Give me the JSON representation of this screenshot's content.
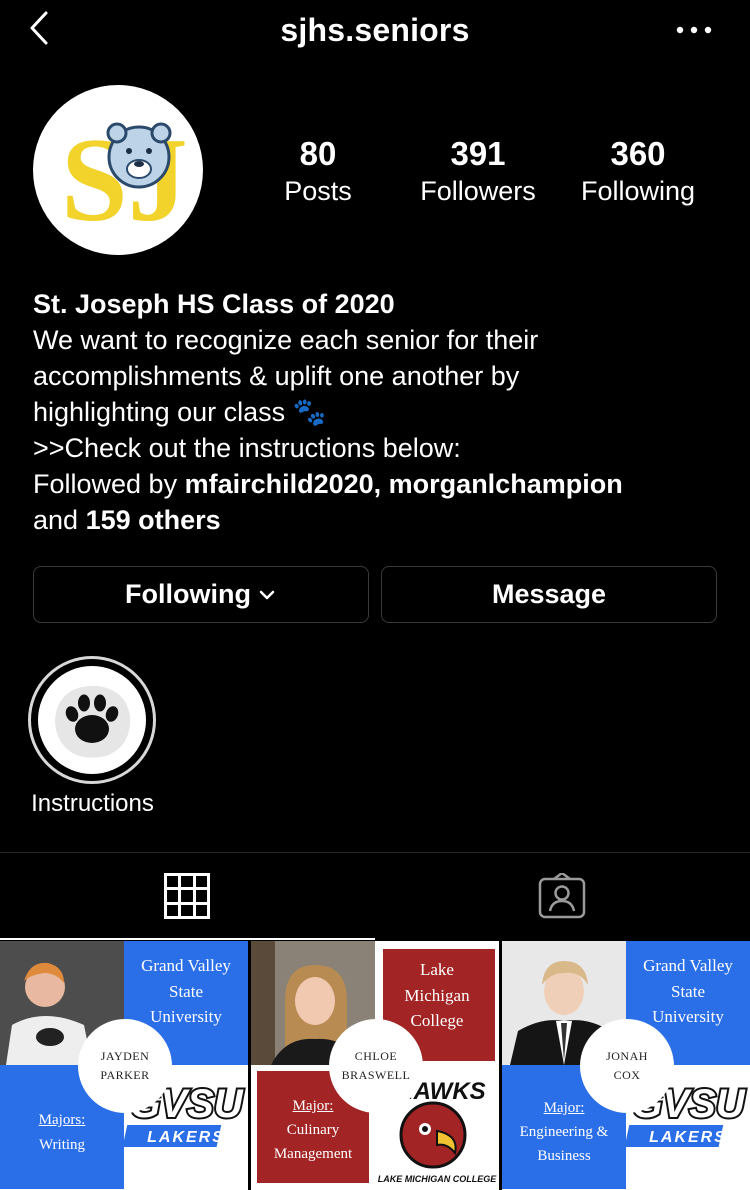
{
  "header": {
    "username": "sjhs.seniors"
  },
  "profile": {
    "avatar_text": "SJ",
    "stats": [
      {
        "value": "80",
        "label": "Posts"
      },
      {
        "value": "391",
        "label": "Followers"
      },
      {
        "value": "360",
        "label": "Following"
      }
    ],
    "display_name": "St. Joseph HS Class of 2020",
    "bio_lines": [
      "We want to recognize each senior for their",
      "accomplishments & uplift one another by",
      "highlighting our class 🐾",
      ">>Check out the instructions below:"
    ],
    "followed_by_prefix": "Followed by ",
    "followed_by_users": "mfairchild2020, morganlchampion",
    "followed_by_and": "and ",
    "followed_by_others": "159 others"
  },
  "actions": {
    "following_label": "Following",
    "message_label": "Message"
  },
  "highlights": [
    {
      "label": "Instructions"
    }
  ],
  "tabs": [
    {
      "icon": "grid-icon"
    },
    {
      "icon": "tagged-icon"
    }
  ],
  "posts": [
    {
      "university": [
        "Grand Valley",
        "State",
        "University"
      ],
      "first_name": "JAYDEN",
      "last_name": "PARKER",
      "major_label": "Majors:",
      "major": [
        "Writing"
      ],
      "logo_main": "GVSU",
      "logo_sub": "LAKERS"
    },
    {
      "university": [
        "Lake",
        "Michigan",
        "College"
      ],
      "first_name": "CHLOE",
      "last_name": "BRASWELL",
      "major_label": "Major:",
      "major": [
        "Culinary",
        "Management"
      ],
      "logo_main": "HAWKS",
      "logo_sub": "LAKE MICHIGAN COLLEGE"
    },
    {
      "university": [
        "Grand Valley",
        "State",
        "University"
      ],
      "first_name": "JONAH",
      "last_name": "COX",
      "major_label": "Major:",
      "major": [
        "Engineering &",
        "Business"
      ],
      "logo_main": "GVSU",
      "logo_sub": "LAKERS"
    }
  ],
  "colors": {
    "background": "#000000",
    "gvsu_blue": "#2a6ee8",
    "lmc_maroon": "#a22424",
    "sj_yellow": "#f2d32b"
  }
}
